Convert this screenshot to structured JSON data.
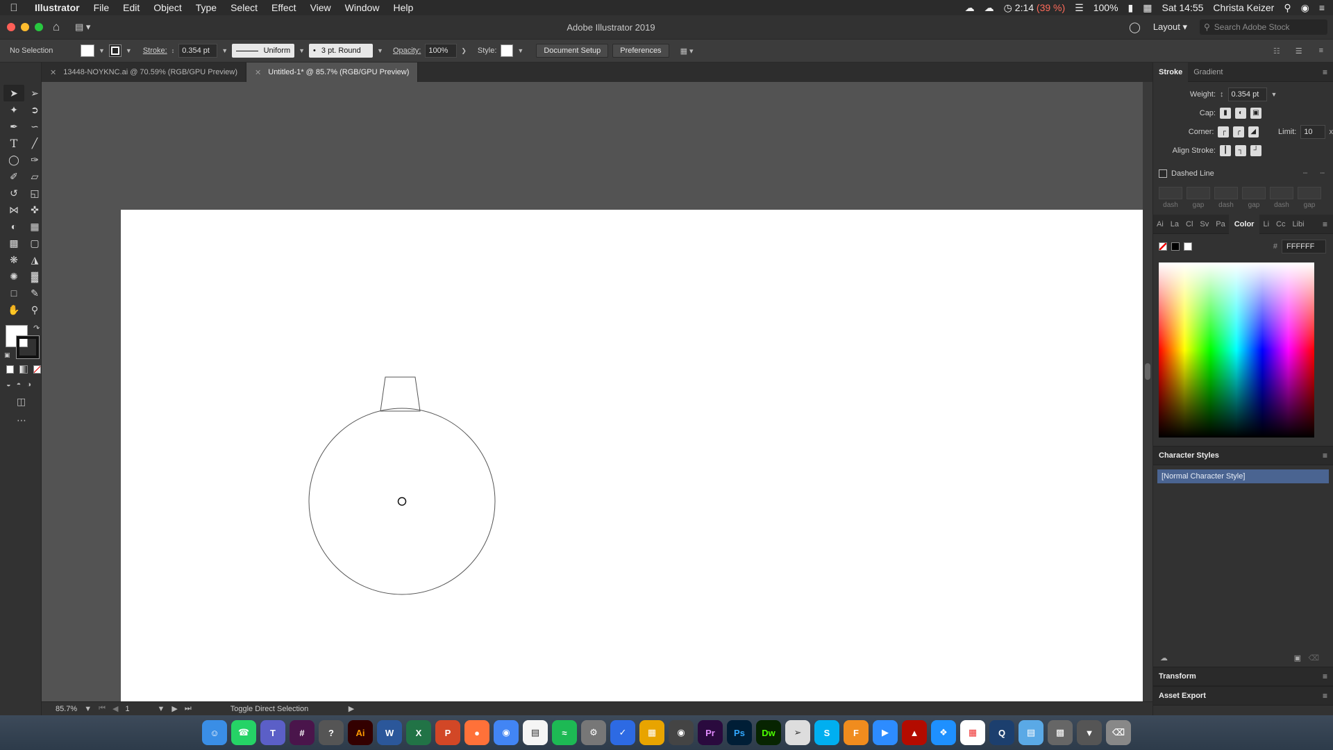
{
  "menubar": {
    "app_name": "Illustrator",
    "items": [
      "File",
      "Edit",
      "Object",
      "Type",
      "Select",
      "Effect",
      "View",
      "Window",
      "Help"
    ],
    "battery_time": "2:14",
    "battery_pct_paren": "(39 %)",
    "battery_level": "100%",
    "clock": "Sat 14:55",
    "user": "Christa Keizer"
  },
  "titlebar": {
    "title": "Adobe Illustrator 2019",
    "layout_label": "Layout",
    "search_placeholder": "Search Adobe Stock"
  },
  "controlbar": {
    "selection": "No Selection",
    "stroke_label": "Stroke:",
    "stroke_value": "0.354 pt",
    "profile": "Uniform",
    "brush": "3 pt. Round",
    "opacity_label": "Opacity:",
    "opacity_value": "100%",
    "style_label": "Style:",
    "document_setup": "Document Setup",
    "preferences": "Preferences"
  },
  "tabs": [
    {
      "label": "13448-NOYKNC.ai @ 70.59% (RGB/GPU Preview)",
      "active": false
    },
    {
      "label": "Untitled-1* @ 85.7% (RGB/GPU Preview)",
      "active": true
    }
  ],
  "statusbar": {
    "zoom": "85.7%",
    "artboard": "1",
    "tool_hint": "Toggle Direct Selection"
  },
  "stroke_panel": {
    "tab_stroke": "Stroke",
    "tab_gradient": "Gradient",
    "weight_label": "Weight:",
    "weight_value": "0.354 pt",
    "cap_label": "Cap:",
    "corner_label": "Corner:",
    "limit_label": "Limit:",
    "limit_value": "10",
    "align_label": "Align Stroke:",
    "dashed_label": "Dashed Line",
    "dash_labels": [
      "dash",
      "gap",
      "dash",
      "gap",
      "dash",
      "gap"
    ]
  },
  "color_panel": {
    "tabs": [
      "Ai",
      "La",
      "Cl",
      "Sv",
      "Pa",
      "Color",
      "Li",
      "Cc",
      "Libi"
    ],
    "hex_symbol": "#",
    "hex": "FFFFFF"
  },
  "char_styles": {
    "title": "Character Styles",
    "item": "[Normal Character Style]"
  },
  "transform_title": "Transform",
  "asset_export_title": "Asset Export",
  "colors": {
    "panel_bg": "#323232",
    "canvas_bg": "#535353",
    "artboard": "#ffffff",
    "selection_highlight": "#4a6491"
  }
}
